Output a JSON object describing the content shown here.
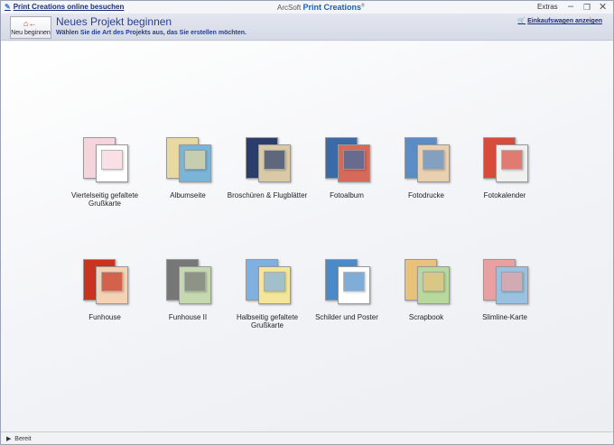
{
  "titlebar": {
    "online_link": "Print Creations online besuchen",
    "brand": "ArcSoft",
    "product": "Print Creations",
    "extras": "Extras"
  },
  "header": {
    "new_button": "Neu beginnen",
    "title": "Neues Projekt beginnen",
    "subtitle": "Wählen Sie die Art des Projekts aus, das Sie erstellen möchten.",
    "cart_link": "Einkaufswagen anzeigen"
  },
  "projects": [
    {
      "label": "Viertelseitig gefaltete Grußkarte",
      "c1": "#f6d4dc",
      "c2": "#ffffff"
    },
    {
      "label": "Albumseite",
      "c1": "#e8d9a0",
      "c2": "#7ab4d6"
    },
    {
      "label": "Broschüren & Flugblätter",
      "c1": "#2b3e6b",
      "c2": "#d9c9a6"
    },
    {
      "label": "Fotoalbum",
      "c1": "#3b6aa8",
      "c2": "#d66a5a"
    },
    {
      "label": "Fotodrucke",
      "c1": "#5a8cc8",
      "c2": "#e8d0b0"
    },
    {
      "label": "Fotokalender",
      "c1": "#d84b3a",
      "c2": "#f0f0f0"
    },
    {
      "label": "Funhouse",
      "c1": "#c8341f",
      "c2": "#f3d2b5"
    },
    {
      "label": "Funhouse II",
      "c1": "#777777",
      "c2": "#c5d8b0"
    },
    {
      "label": "Halbseitig gefaltete Grußkarte",
      "c1": "#7fb0e0",
      "c2": "#f3e69a"
    },
    {
      "label": "Schilder und Poster",
      "c1": "#4b8ac8",
      "c2": "#ffffff"
    },
    {
      "label": "Scrapbook",
      "c1": "#e8c27a",
      "c2": "#b8d8a0"
    },
    {
      "label": "Slimline-Karte",
      "c1": "#e9a0a0",
      "c2": "#9ac2e0"
    }
  ],
  "status": {
    "text": "Bereit"
  }
}
